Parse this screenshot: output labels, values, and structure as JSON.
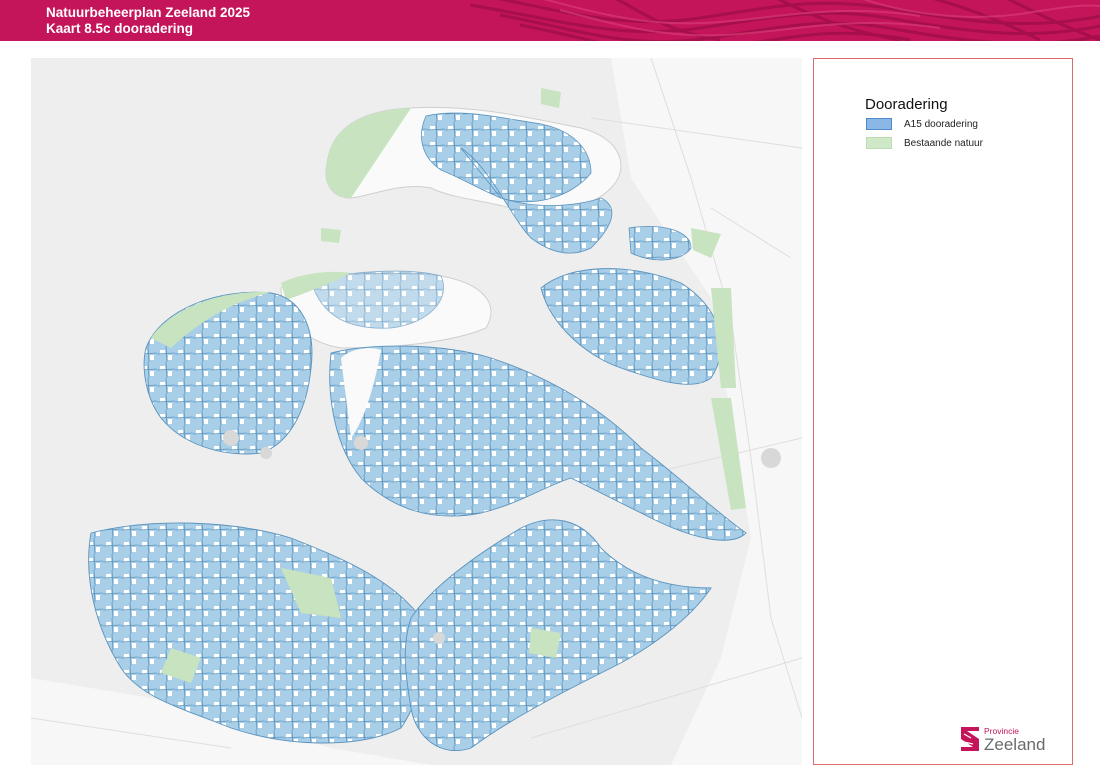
{
  "header": {
    "title_line1": "Natuurbeheerplan Zeeland 2025",
    "title_line2": "Kaart 8.5c dooradering",
    "color": "#c4145a"
  },
  "map": {
    "subject": "Zeeland province",
    "colors": {
      "dooradering_fill": "#a9cfe8",
      "dooradering_edge": "#5b93bd",
      "natuur_fill": "#c8e3c0",
      "land_fill": "#fafafa",
      "water_fill": "#eeeeee"
    }
  },
  "legend": {
    "title": "Dooradering",
    "items": [
      {
        "label": "A15 dooradering",
        "color": "#8ab7e6"
      },
      {
        "label": "Bestaande natuur",
        "color": "#cfe8c8"
      }
    ]
  },
  "logo": {
    "line1": "Provincie",
    "line2": "Zeeland"
  }
}
